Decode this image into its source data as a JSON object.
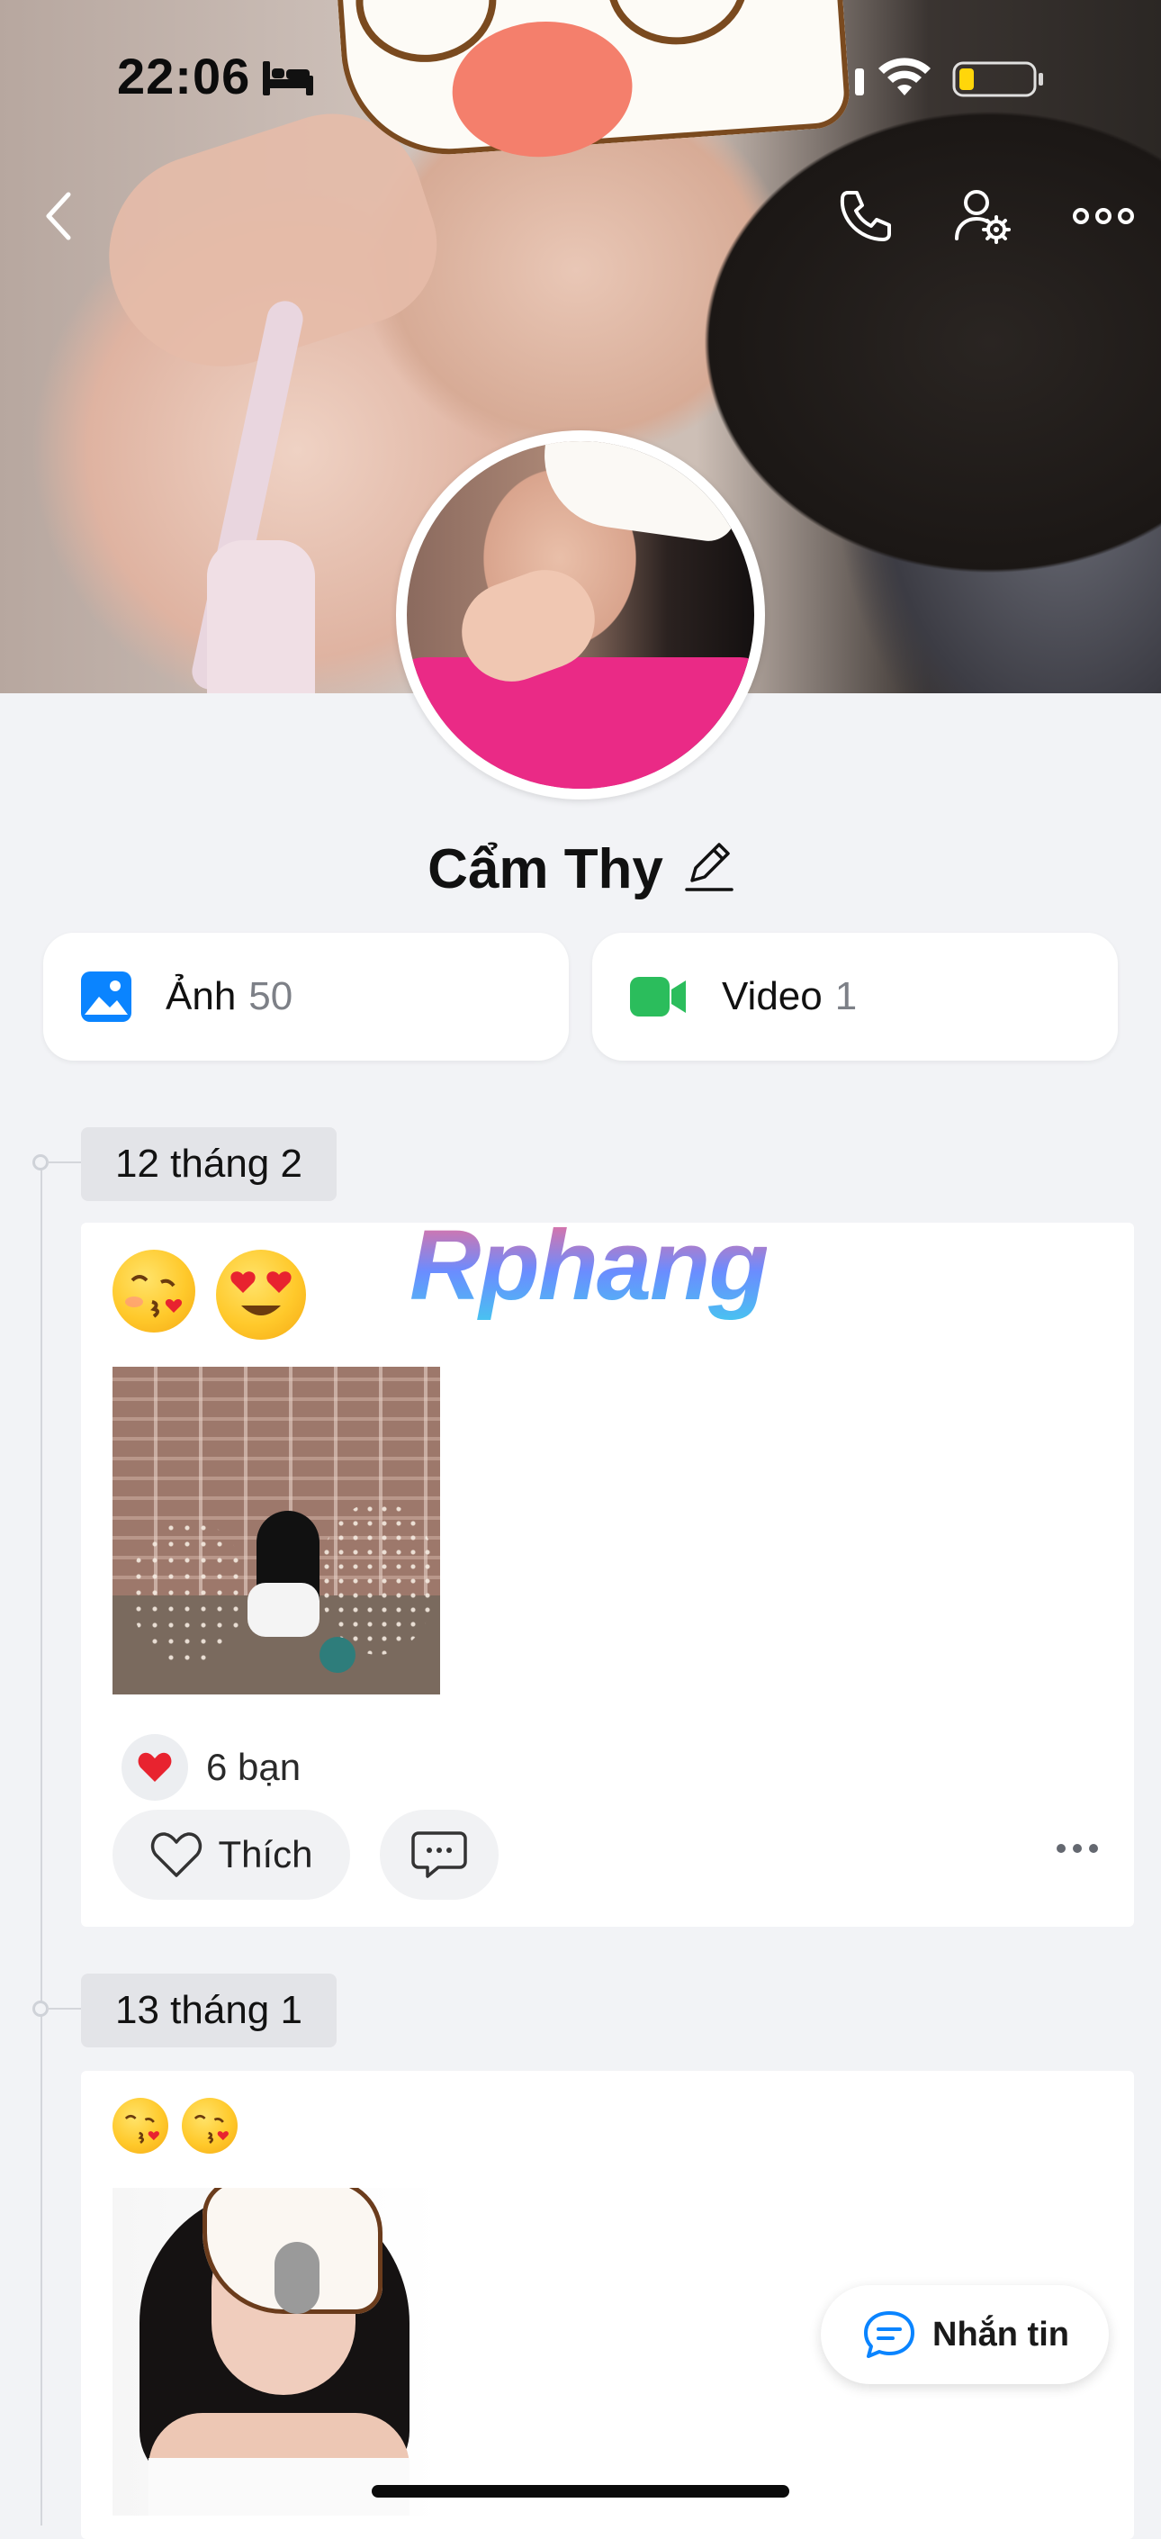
{
  "status_bar": {
    "time": "22:06"
  },
  "profile": {
    "name": "Cẩm Thy"
  },
  "media": {
    "photos": {
      "label": "Ảnh",
      "count": "50"
    },
    "videos": {
      "label": "Video",
      "count": "1"
    }
  },
  "watermark": "Rphang",
  "posts": [
    {
      "date": "12 tháng 2",
      "emoji": [
        "face-blowing-kiss",
        "smiling-face-heart-eyes"
      ],
      "reactions": "6 bạn",
      "like_label": "Thích"
    },
    {
      "date": "13 tháng 1",
      "emoji": [
        "face-blowing-kiss",
        "face-blowing-kiss"
      ]
    }
  ],
  "message_button": {
    "label": "Nhắn tin"
  },
  "colors": {
    "accent": "#0068ff",
    "video": "#2bbd5c",
    "heart": "#e8232f",
    "background": "#f2f3f6"
  }
}
